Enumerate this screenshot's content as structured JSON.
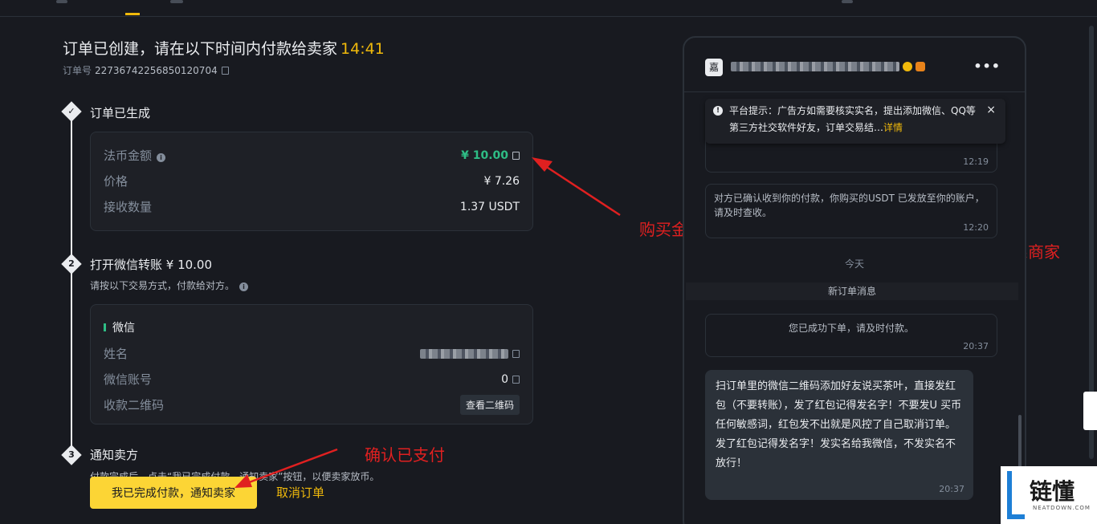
{
  "order": {
    "title": "订单已创建，请在以下时间内付款给卖家",
    "countdown": "14:41",
    "number_label": "订单号",
    "number": "22736742256850120704"
  },
  "steps": [
    {
      "index": "1",
      "title": "订单已生成",
      "rows": [
        {
          "label": "法币金额",
          "value": "¥ 10.00"
        },
        {
          "label": "价格",
          "value": "¥ 7.26"
        },
        {
          "label": "接收数量",
          "value": "1.37 USDT"
        }
      ]
    },
    {
      "index": "2",
      "title": "打开微信转账 ¥ 10.00",
      "desc": "请按以下交易方式，付款给对方。",
      "method": "微信",
      "rows": [
        {
          "label": "姓名",
          "value": ""
        },
        {
          "label": "微信账号",
          "value": "0"
        },
        {
          "label": "收款二维码",
          "value": "查看二维码"
        }
      ]
    },
    {
      "index": "3",
      "title": "通知卖方",
      "desc": "付款完成后，点击“我已完成付款，通知卖家”按钮，以便卖家放币。"
    }
  ],
  "actions": {
    "confirm_label": "我已完成付款，通知卖家",
    "cancel_label": "取消订单"
  },
  "annotations": {
    "amount": "购买金额",
    "contact": "联系商家",
    "confirm": "确认已支付"
  },
  "chat": {
    "avatar_char": "嘉",
    "more": "•••",
    "notice": {
      "text": "平台提示：广告方如需要核实实名，提出添加微信、QQ等第三方社交软件好友，订单交易结…",
      "link": "详情",
      "close": "×"
    },
    "messages": [
      {
        "text": "",
        "time": "12:19"
      },
      {
        "text": "对方已确认收到你的付款，你购买的USDT 已发放至你的账户，请及时查收。",
        "time": "12:20"
      },
      {
        "text": "您已成功下单，请及时付款。",
        "time": "20:37"
      },
      {
        "text": "扫订单里的微信二维码添加好友说买茶叶，直接发红包（不要转账），发了红包记得发名字！不要发U 买币任何敏感词，红包发不出就是风控了自己取消订单。发了红包记得发名字！发实名给我微信，不发实名不放行！",
        "time": "20:37"
      }
    ],
    "day_label": "今天",
    "new_order_label": "新订单消息"
  },
  "watermark": {
    "cn": "链懂",
    "en": "NEATDOWN.COM"
  },
  "colors": {
    "accent": "#f0b90b",
    "button": "#fcd535",
    "green": "#2ebd85",
    "annotation": "#e02020",
    "background": "#181a20"
  }
}
